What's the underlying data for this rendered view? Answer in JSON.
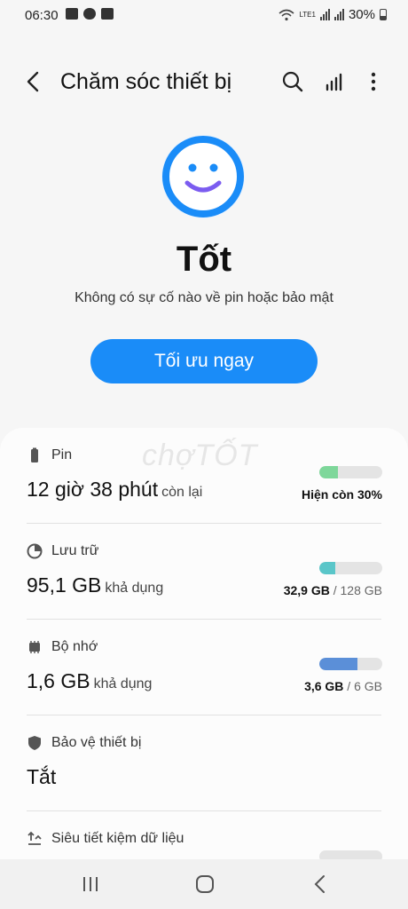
{
  "status_bar": {
    "time": "06:30",
    "battery": "30%",
    "network": "LTE1"
  },
  "header": {
    "title": "Chăm sóc thiết bị"
  },
  "status": {
    "word": "Tốt",
    "description": "Không có sự cố nào về pin hoặc bảo mật",
    "button_label": "Tối ưu ngay"
  },
  "watermark": "chợTỐT",
  "items": [
    {
      "label": "Pin",
      "value": "12 giờ 38 phút",
      "suffix": "còn lại",
      "right_bold": "Hiện còn 30%",
      "right_rest": "",
      "level": 0.3,
      "color": "#7ed79a"
    },
    {
      "label": "Lưu trữ",
      "value": "95,1 GB",
      "suffix": "khả dụng",
      "right_bold": "32,9 GB",
      "right_rest": " / 128 GB",
      "level": 0.257,
      "color": "#5ac6c9"
    },
    {
      "label": "Bộ nhớ",
      "value": "1,6 GB",
      "suffix": "khả dụng",
      "right_bold": "3,6 GB",
      "right_rest": " / 6 GB",
      "level": 0.6,
      "color": "#5b8fd8"
    },
    {
      "label": "Bảo vệ thiết bị",
      "value": "Tắt"
    },
    {
      "label": "Siêu tiết kiệm dữ liệu"
    }
  ],
  "colors": {
    "accent": "#1a8cf8",
    "face_ring": "#1a8cf8",
    "smile": "#7b5cf0"
  }
}
